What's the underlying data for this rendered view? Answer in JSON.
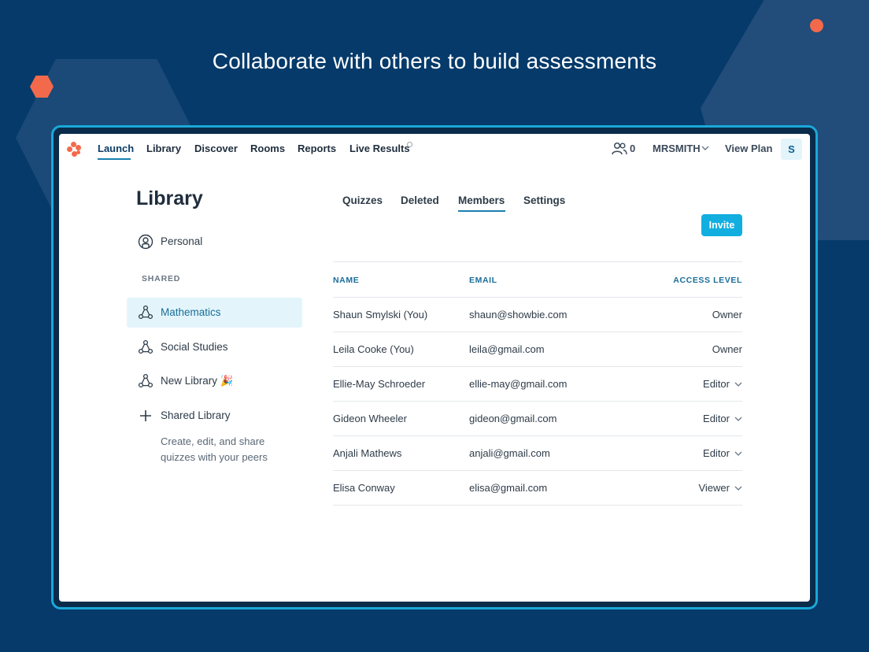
{
  "headline": "Collaborate with others to build assessments",
  "colors": {
    "background": "#053a6a",
    "accent": "#12aee0",
    "brand_orange": "#f26a4b",
    "frame": "#1aa8d8"
  },
  "nav": {
    "items": [
      "Launch",
      "Library",
      "Discover",
      "Rooms",
      "Reports",
      "Live Results"
    ],
    "active": "Launch",
    "participants_count": "0",
    "user": "MRSMITH",
    "view_plan": "View Plan",
    "avatar_initial": "S"
  },
  "sidebar": {
    "title": "Library",
    "personal": "Personal",
    "shared_header": "SHARED",
    "items": [
      {
        "label": "Mathematics",
        "icon": "share-network-icon",
        "active": true
      },
      {
        "label": "Social Studies",
        "icon": "share-network-icon",
        "active": false
      },
      {
        "label": "New Library 🎉",
        "icon": "share-network-icon",
        "active": false
      }
    ],
    "add_shared": "Shared Library",
    "help_text": "Create, edit, and share quizzes with your peers"
  },
  "tabs": {
    "items": [
      "Quizzes",
      "Deleted",
      "Members",
      "Settings"
    ],
    "active": "Members"
  },
  "invite_label": "Invite",
  "members_table": {
    "columns": [
      "NAME",
      "EMAIL",
      "ACCESS LEVEL"
    ],
    "rows": [
      {
        "name": "Shaun Smylski (You)",
        "email": "shaun@showbie.com",
        "access": "Owner",
        "editable": false
      },
      {
        "name": "Leila Cooke (You)",
        "email": "leila@gmail.com",
        "access": "Owner",
        "editable": false
      },
      {
        "name": "Ellie-May Schroeder",
        "email": "ellie-may@gmail.com",
        "access": "Editor",
        "editable": true
      },
      {
        "name": "Gideon Wheeler",
        "email": "gideon@gmail.com",
        "access": "Editor",
        "editable": true
      },
      {
        "name": "Anjali Mathews",
        "email": "anjali@gmail.com",
        "access": "Editor",
        "editable": true
      },
      {
        "name": "Elisa Conway",
        "email": "elisa@gmail.com",
        "access": "Viewer",
        "editable": true
      }
    ]
  }
}
